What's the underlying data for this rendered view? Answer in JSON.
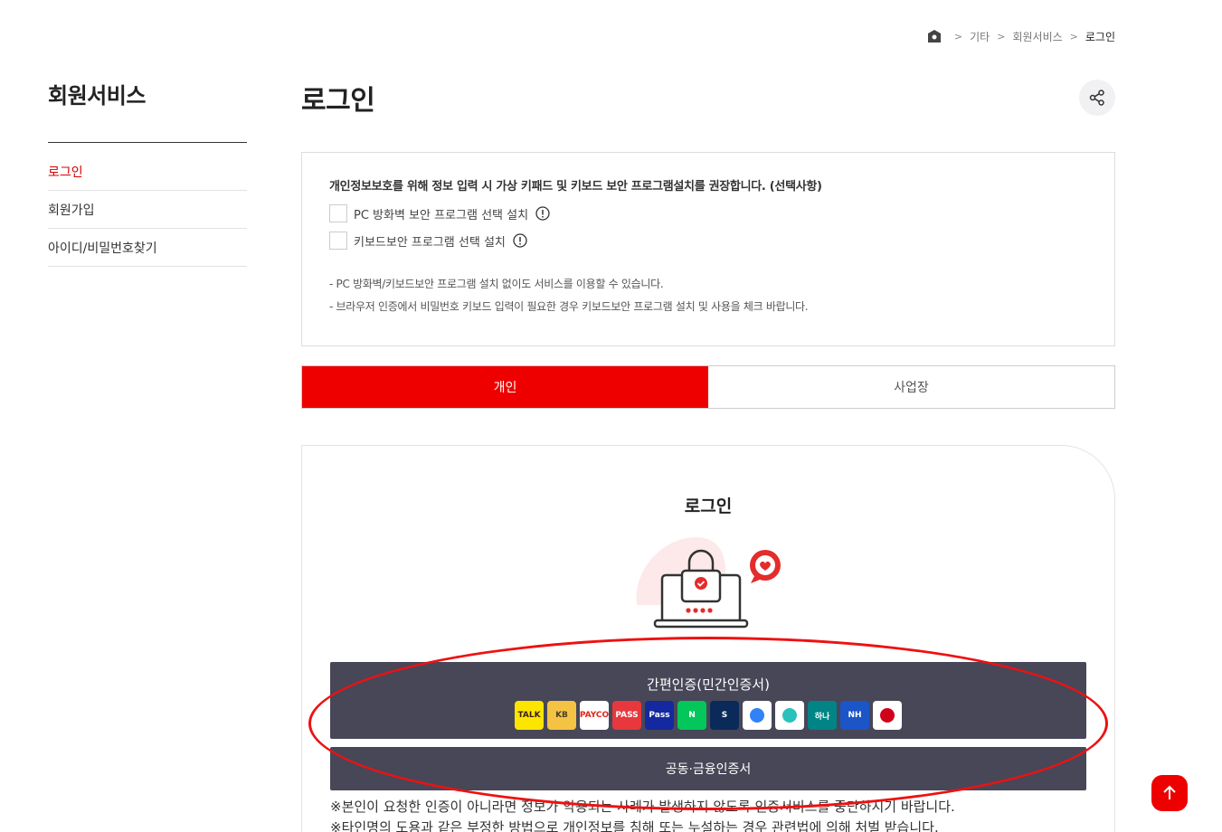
{
  "breadcrumb": {
    "items": [
      "기타",
      "회원서비스"
    ],
    "current": "로그인"
  },
  "sidebar": {
    "title": "회원서비스",
    "items": [
      {
        "label": "로그인",
        "active": true
      },
      {
        "label": "회원가입",
        "active": false
      },
      {
        "label": "아이디/비밀번호찾기",
        "active": false
      }
    ]
  },
  "page": {
    "title": "로그인"
  },
  "notice": {
    "heading": "개인정보보호를 위해 정보 입력 시 가상 키패드 및 키보드 보안 프로그램설치를 권장합니다. (선택사항)",
    "options": [
      "PC 방화벽 보안 프로그램 선택 설치",
      "키보드보안 프로그램 선택 설치"
    ],
    "bullets": [
      "PC 방화벽/키보드보안 프로그램 설치 없이도 서비스를 이용할 수 있습니다.",
      "브라우저 인증에서 비밀번호 키보드 입력이 필요한 경우 키보드보안 프로그램 설치 및 사용을 체크 바랍니다."
    ]
  },
  "tabs": [
    {
      "label": "개인",
      "active": true
    },
    {
      "label": "사업장",
      "active": false
    }
  ],
  "login": {
    "title": "로그인",
    "easy_auth_label": "간편인증(민간인증서)",
    "providers": [
      {
        "name": "kakao-icon",
        "text": "TALK",
        "bg": "#fee500",
        "fg": "#3c1e1e"
      },
      {
        "name": "kb-icon",
        "text": "KB",
        "bg": "#f5c343",
        "fg": "#4b3e2a"
      },
      {
        "name": "payco-icon",
        "text": "PAYCO",
        "bg": "#ffffff",
        "fg": "#e1251b"
      },
      {
        "name": "pass-icon",
        "text": "PASS",
        "bg": "#e8383d",
        "fg": "#ffffff"
      },
      {
        "name": "samsung-pass-icon",
        "text": "Pass",
        "bg": "#1428a0",
        "fg": "#ffffff"
      },
      {
        "name": "naver-icon",
        "text": "N",
        "bg": "#03c75a",
        "fg": "#ffffff"
      },
      {
        "name": "shinhan-icon",
        "text": "S",
        "bg": "#0a2a5a",
        "fg": "#ffffff"
      },
      {
        "name": "toss-icon",
        "text": "",
        "bg": "#ffffff",
        "fg": "#3182f6"
      },
      {
        "name": "banksalad-icon",
        "text": "",
        "bg": "#ffffff",
        "fg": "#2ac1bc"
      },
      {
        "name": "hana-icon",
        "text": "하나",
        "bg": "#008485",
        "fg": "#ffffff"
      },
      {
        "name": "nh-icon",
        "text": "NH",
        "bg": "#1c55c7",
        "fg": "#ffffff"
      },
      {
        "name": "kftc-icon",
        "text": "",
        "bg": "#ffffff",
        "fg": "#d0021b"
      }
    ],
    "cert_label": "공동·금융인증서",
    "warnings": [
      "※본인이 요청한 인증이 아니라면 정보가 악용되는 사례가 발생하지 않도록 인증서비스를 중단하시기 바랍니다.",
      "※타인명의 도용과 같은 부정한 방법으로 개인정보를 침해 또는 누설하는 경우 관련법에 의해 처벌 받습니다."
    ]
  },
  "colors": {
    "accent": "#ee0000",
    "button_dark": "#474758",
    "annotation": "#e11111"
  }
}
